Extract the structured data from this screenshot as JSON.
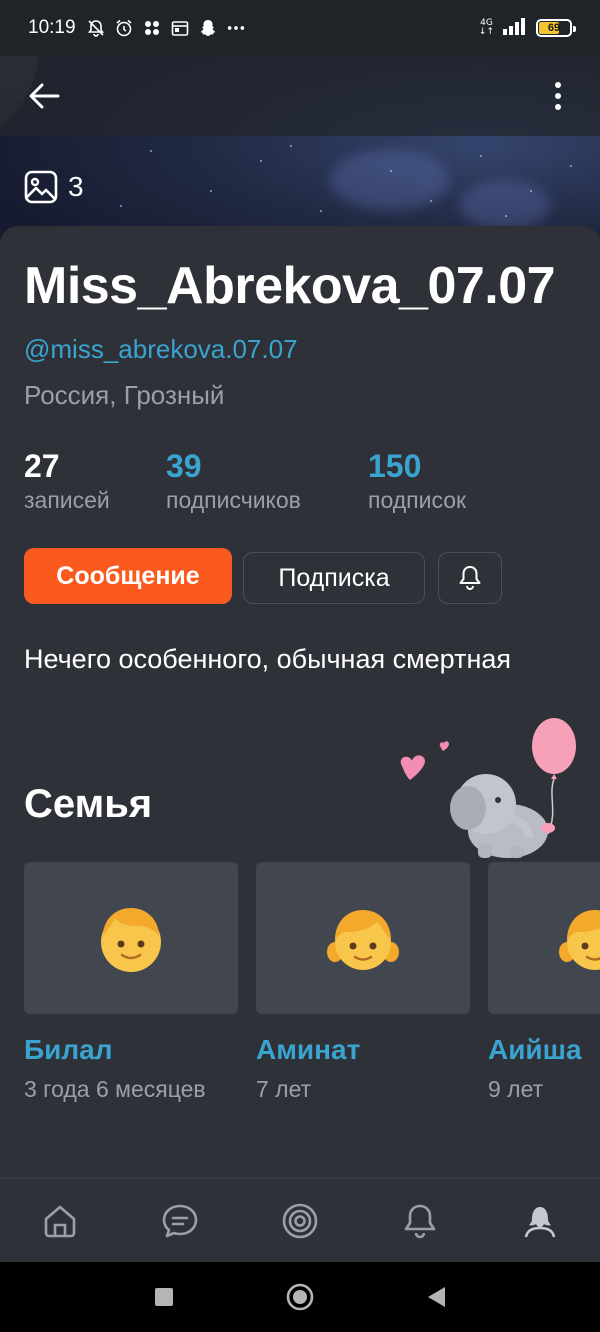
{
  "status_bar": {
    "time": "10:19",
    "icons": [
      "bell-off-icon",
      "alarm-icon",
      "dots-app-icon",
      "calendar-icon",
      "snapchat-icon",
      "more-dots-icon"
    ],
    "network": "4G",
    "battery": "69",
    "battery_level": 0.69,
    "battery_color": "#f2c230"
  },
  "app_bar": {
    "back_icon": "arrow-left-icon",
    "menu_icon": "vertical-dots-icon"
  },
  "cover": {
    "photo_count": "3",
    "photo_icon": "image-icon"
  },
  "profile": {
    "name": "Miss_Abrekova_07.07",
    "handle": "@miss_abrekova.07.07",
    "location": "Россия, Грозный",
    "stats": [
      {
        "value": "27",
        "label": "записей"
      },
      {
        "value": "39",
        "label": "подписчиков"
      },
      {
        "value": "150",
        "label": "подписок"
      }
    ],
    "message_button": "Сообщение",
    "subscribe_button": "Подписка",
    "bio": "Нечего особенного, обычная смертная"
  },
  "family": {
    "title": "Семья",
    "members": [
      {
        "name": "Билал",
        "age": "3 года 6 месяцев",
        "emoji": "👦"
      },
      {
        "name": "Аминат",
        "age": "7 лет",
        "emoji": "👧"
      },
      {
        "name": "Аийша",
        "age": "9 лет",
        "emoji": "👧"
      }
    ]
  },
  "bottom_nav": {
    "items": [
      "home-icon",
      "chat-icon",
      "target-icon",
      "bell-icon",
      "profile-icon"
    ]
  },
  "system_nav": {
    "items": [
      "recents-square-icon",
      "home-circle-icon",
      "back-triangle-icon"
    ]
  },
  "colors": {
    "accent_orange": "#fb5a1e",
    "link_blue": "#3aa3cf",
    "background": "#2e3238",
    "muted_text": "#9aa0a8"
  }
}
